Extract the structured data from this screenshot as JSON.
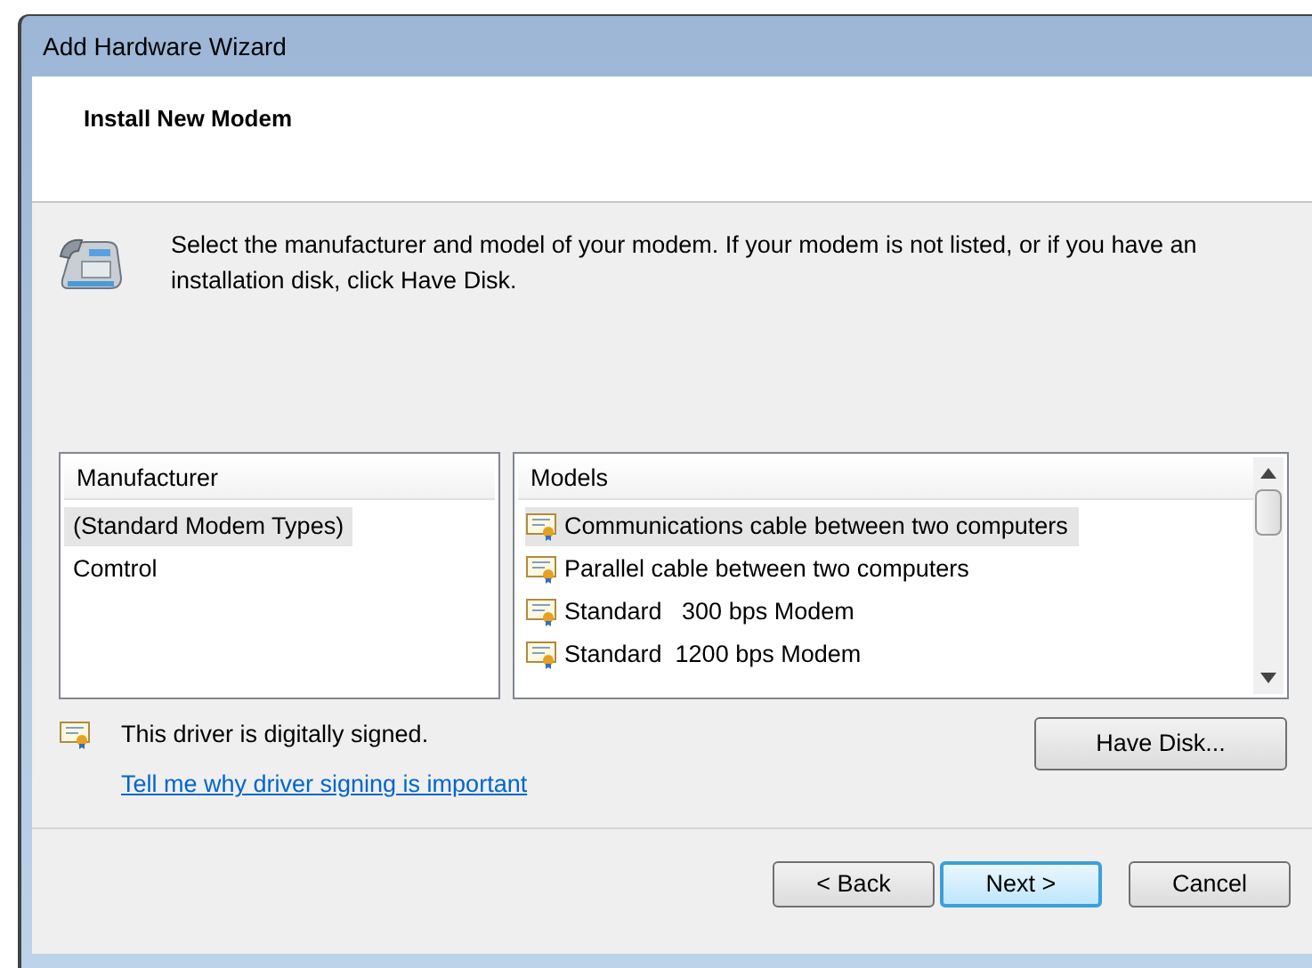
{
  "window": {
    "title": "Add Hardware Wizard"
  },
  "header": {
    "title": "Install New Modem"
  },
  "instructions": "Select the manufacturer and model of your modem. If your modem is not listed, or if you have an installation disk, click Have Disk.",
  "manufacturers": {
    "heading": "Manufacturer",
    "items": [
      {
        "label": "(Standard Modem Types)",
        "selected": true
      },
      {
        "label": "Comtrol",
        "selected": false
      }
    ]
  },
  "models": {
    "heading": "Models",
    "items": [
      {
        "label": "Communications cable between two computers",
        "selected": true
      },
      {
        "label": "Parallel cable between two computers",
        "selected": false
      },
      {
        "label": "Standard   300 bps Modem",
        "selected": false
      },
      {
        "label": "Standard  1200 bps Modem",
        "selected": false
      }
    ]
  },
  "signature": {
    "text": "This driver is digitally signed.",
    "link": "Tell me why driver signing is important"
  },
  "have_disk_button": "Have Disk...",
  "buttons": [
    {
      "label": "< Back",
      "default": false
    },
    {
      "label": "Next >",
      "default": true
    },
    {
      "label": "Cancel",
      "default": false
    }
  ]
}
